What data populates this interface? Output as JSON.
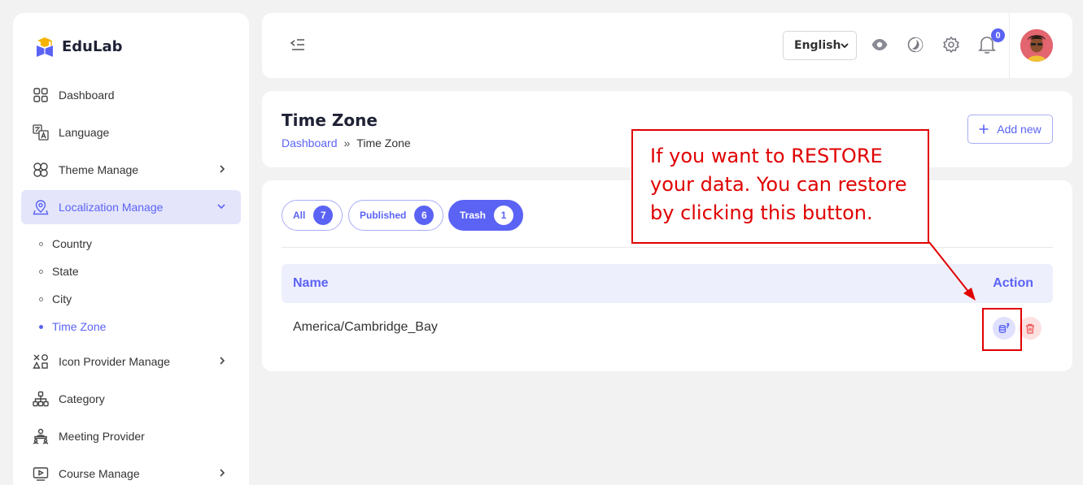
{
  "brand": {
    "name": "EduLab"
  },
  "sidebar": {
    "items": [
      {
        "label": "Dashboard",
        "icon": "grid-icon"
      },
      {
        "label": "Language",
        "icon": "translate-icon"
      },
      {
        "label": "Theme Manage",
        "icon": "flower-icon",
        "has_children": true
      },
      {
        "label": "Localization Manage",
        "icon": "map-pin-icon",
        "active": true,
        "expanded": true
      },
      {
        "label": "Icon Provider Manage",
        "icon": "shapes-icon",
        "has_children": true
      },
      {
        "label": "Category",
        "icon": "hierarchy-icon"
      },
      {
        "label": "Meeting Provider",
        "icon": "meeting-icon"
      },
      {
        "label": "Course Manage",
        "icon": "video-icon",
        "has_children": true
      }
    ],
    "localization_sub": [
      {
        "label": "Country"
      },
      {
        "label": "State"
      },
      {
        "label": "City"
      },
      {
        "label": "Time Zone",
        "active": true
      }
    ]
  },
  "header": {
    "language": "English",
    "notification_count": "0"
  },
  "page": {
    "title": "Time Zone",
    "breadcrumb": {
      "home": "Dashboard",
      "separator": "»",
      "current": "Time Zone"
    },
    "add_button": "Add new"
  },
  "tabs": [
    {
      "label": "All",
      "count": "7"
    },
    {
      "label": "Published",
      "count": "6"
    },
    {
      "label": "Trash",
      "count": "1",
      "active": true
    }
  ],
  "table": {
    "columns": [
      "Name",
      "Action"
    ],
    "rows": [
      {
        "name": "America/Cambridge_Bay"
      }
    ]
  },
  "annotation": {
    "text": "If you want to RESTORE your data. You can restore by clicking this button."
  },
  "colors": {
    "accent": "#5b63f5",
    "annotation": "#e00000",
    "danger": "#f05252"
  }
}
